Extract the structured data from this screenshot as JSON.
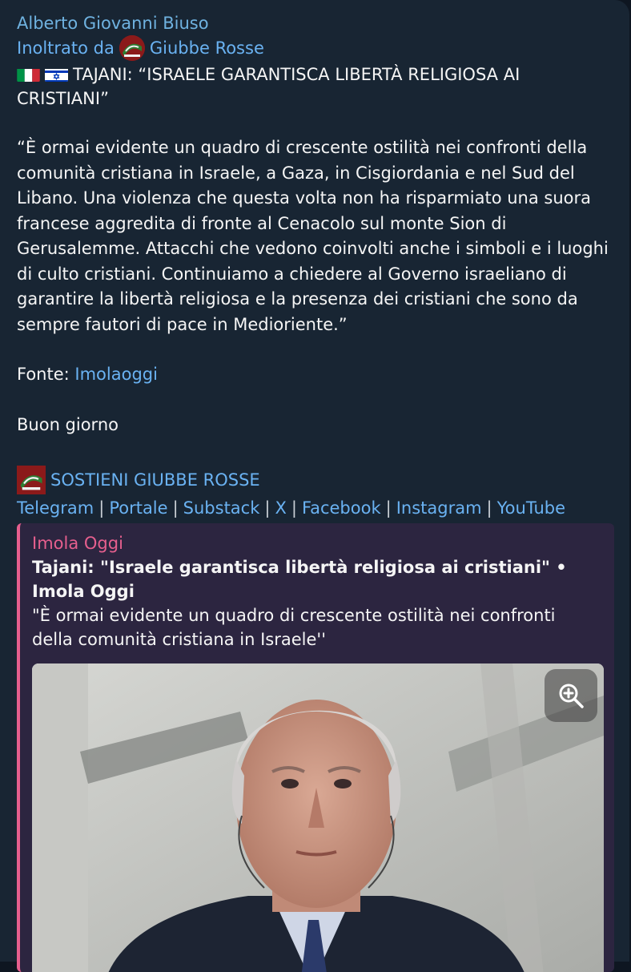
{
  "message": {
    "sender": "Alberto Giovanni Biuso",
    "forwarded_prefix": "Inoltrato da",
    "forwarded_channel": "Giubbe Rosse",
    "title": "TAJANI: “ISRAELE GARANTISCA LIBERTÀ RELIGIOSA AI CRISTIANI”",
    "quote": "“È ormai evidente un quadro di crescente ostilità nei confronti della comunità cristiana in Israele, a Gaza, in Cisgiordania e nel Sud del Libano. Una violenza che questa volta non ha risparmiato una suora francese aggredita di fronte al Cenacolo sul monte Sion di Gerusalemme. Attacchi che vedono coinvolti anche i simboli e i luoghi di culto cristiani. Continuiamo a chiedere al Governo israeliano di garantire la libertà religiosa e la presenza dei cristiani che sono da sempre fautori di pace in Medioriente.”",
    "source_label": "Fonte:",
    "source_link": "Imolaoggi",
    "greeting": "Buon giorno",
    "support_label": "SOSTIENI GIUBBE ROSSE",
    "links": [
      "Telegram",
      "Portale",
      "Substack",
      "X",
      "Facebook",
      "Instagram",
      "YouTube"
    ],
    "separator": "|"
  },
  "preview": {
    "site": "Imola Oggi",
    "title": "Tajani: \"Israele garantisca libertà religiosa ai cristiani\" • Imola Oggi",
    "description": "\"È ormai evidente un quadro di crescente ostilità nei confronti della comunità cristiana in Israele''"
  },
  "colors": {
    "background": "#182533",
    "link": "#6ab2f2",
    "preview_accent": "#e65f8e",
    "preview_background": "#2c2540"
  },
  "icons": [
    "italy-flag-icon",
    "israel-flag-icon",
    "channel-avatar",
    "zoom-in-icon"
  ]
}
